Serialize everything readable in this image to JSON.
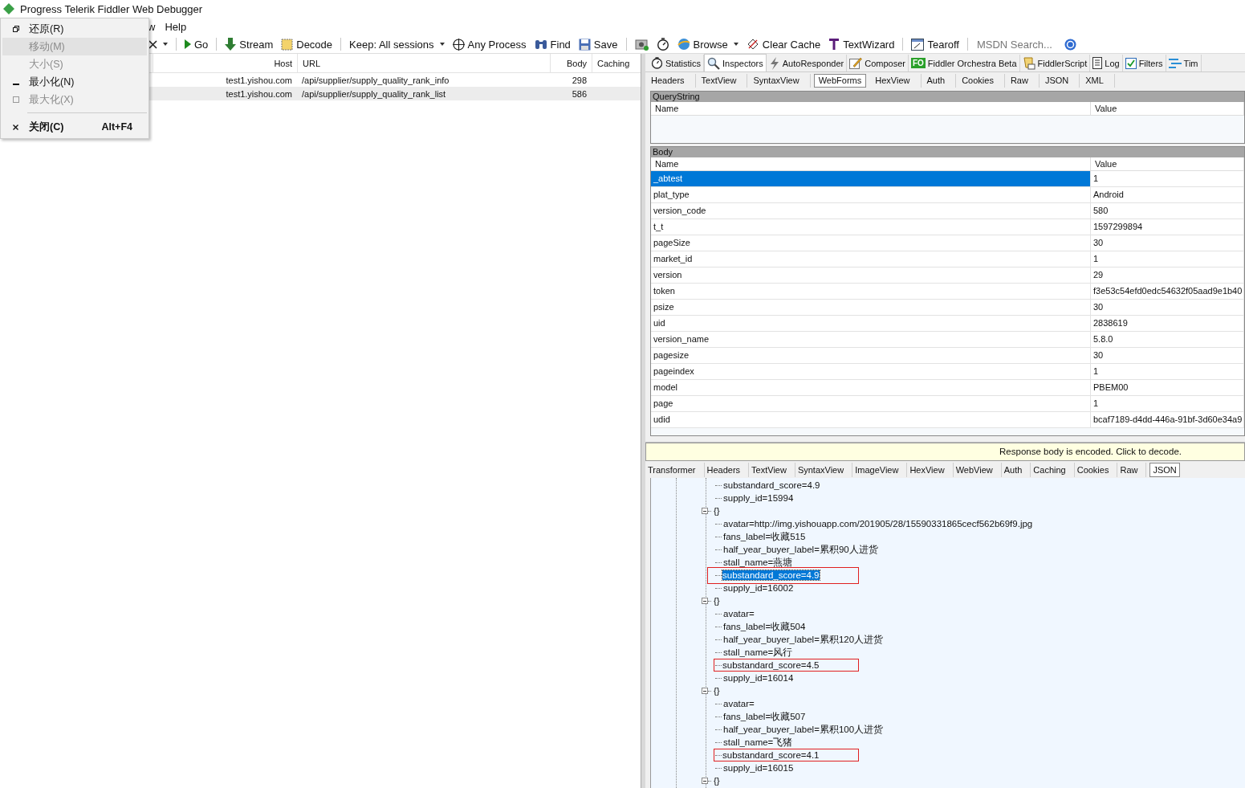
{
  "window": {
    "title": "Progress Telerik Fiddler Web Debugger"
  },
  "menu_bar": [
    "w",
    "Help"
  ],
  "toolbar": [
    {
      "kind": "remove",
      "dropdown": true
    },
    {
      "kind": "separator"
    },
    {
      "kind": "go",
      "label": "Go"
    },
    {
      "kind": "separator"
    },
    {
      "kind": "stream",
      "label": "Stream"
    },
    {
      "kind": "decode",
      "label": "Decode"
    },
    {
      "kind": "separator"
    },
    {
      "kind": "text",
      "label": "Keep: All sessions",
      "dropdown": true
    },
    {
      "kind": "process",
      "label": "Any Process"
    },
    {
      "kind": "find",
      "label": "Find"
    },
    {
      "kind": "save",
      "label": "Save"
    },
    {
      "kind": "separator"
    },
    {
      "kind": "camera"
    },
    {
      "kind": "timer"
    },
    {
      "kind": "browse",
      "label": "Browse",
      "dropdown": true
    },
    {
      "kind": "clear",
      "label": "Clear Cache"
    },
    {
      "kind": "wizard",
      "label": "TextWizard"
    },
    {
      "kind": "separator"
    },
    {
      "kind": "tearoff",
      "label": "Tearoff"
    },
    {
      "kind": "separator"
    },
    {
      "kind": "search",
      "placeholder": "MSDN Search..."
    },
    {
      "kind": "help"
    }
  ],
  "system_menu": [
    {
      "kind": "restore",
      "label": "还原(R)",
      "disabled": false,
      "selected": false,
      "default": false
    },
    {
      "kind": "move",
      "label": "移动(M)",
      "disabled": true,
      "selected": true,
      "default": false
    },
    {
      "kind": "size",
      "label": "大小(S)",
      "disabled": true,
      "selected": false,
      "default": false
    },
    {
      "kind": "minimize",
      "label": "最小化(N)",
      "disabled": false,
      "selected": false,
      "default": false
    },
    {
      "kind": "maximize",
      "label": "最大化(X)",
      "disabled": true,
      "selected": false,
      "default": false
    },
    {
      "kind": "separator"
    },
    {
      "kind": "close",
      "label": "关闭(C)",
      "shortcut": "Alt+F4",
      "disabled": false,
      "selected": false,
      "default": true
    }
  ],
  "sessions": {
    "columns": [
      "Host",
      "URL",
      "Body",
      "Caching"
    ],
    "rows": [
      {
        "host": "test1.yishou.com",
        "url": "/api/supplier/supply_quality_rank_info",
        "body": "298",
        "selected": false
      },
      {
        "host": "test1.yishou.com",
        "url": "/api/supplier/supply_quality_rank_list",
        "body": "586",
        "selected": true
      }
    ]
  },
  "top_tabs": [
    {
      "kind": "stopwatch",
      "label": "Statistics",
      "selected": false
    },
    {
      "kind": "magnifier",
      "label": "Inspectors",
      "selected": true
    },
    {
      "kind": "bolt",
      "label": "AutoResponder",
      "selected": false
    },
    {
      "kind": "pencil",
      "label": "Composer",
      "selected": false
    },
    {
      "kind": "badge",
      "badge": "FO",
      "label": "Fiddler Orchestra Beta",
      "selected": false
    },
    {
      "kind": "scroll",
      "label": "FiddlerScript",
      "selected": false
    },
    {
      "kind": "document",
      "label": "Log",
      "selected": false
    },
    {
      "kind": "checkbox",
      "label": "Filters",
      "selected": false
    },
    {
      "kind": "lines",
      "label": "Tim",
      "selected": false
    }
  ],
  "request_tabs": [
    {
      "label": "Headers",
      "selected": false
    },
    {
      "label": "TextView",
      "selected": false
    },
    {
      "label": "SyntaxView",
      "selected": false
    },
    {
      "label": "WebForms",
      "selected": true
    },
    {
      "label": "HexView",
      "selected": false
    },
    {
      "label": "Auth",
      "selected": false
    },
    {
      "label": "Cookies",
      "selected": false
    },
    {
      "label": "Raw",
      "selected": false
    },
    {
      "label": "JSON",
      "selected": false
    },
    {
      "label": "XML",
      "selected": false
    }
  ],
  "query_string": {
    "title": "QueryString",
    "columns": [
      "Name",
      "Value"
    ]
  },
  "body": {
    "title": "Body",
    "columns": [
      "Name",
      "Value"
    ],
    "rows": [
      {
        "name": "_abtest",
        "value": "1",
        "selected": true
      },
      {
        "name": "plat_type",
        "value": "Android",
        "selected": false
      },
      {
        "name": "version_code",
        "value": "580",
        "selected": false
      },
      {
        "name": "t_t",
        "value": "1597299894",
        "selected": false
      },
      {
        "name": "pageSize",
        "value": "30",
        "selected": false
      },
      {
        "name": "market_id",
        "value": "1",
        "selected": false
      },
      {
        "name": "version",
        "value": "29",
        "selected": false
      },
      {
        "name": "token",
        "value": "f3e53c54efd0edc54632f05aad9e1b40",
        "selected": false
      },
      {
        "name": "psize",
        "value": "30",
        "selected": false
      },
      {
        "name": "uid",
        "value": "2838619",
        "selected": false
      },
      {
        "name": "version_name",
        "value": "5.8.0",
        "selected": false
      },
      {
        "name": "pagesize",
        "value": "30",
        "selected": false
      },
      {
        "name": "pageindex",
        "value": "1",
        "selected": false
      },
      {
        "name": "model",
        "value": "PBEM00",
        "selected": false
      },
      {
        "name": "page",
        "value": "1",
        "selected": false
      },
      {
        "name": "udid",
        "value": "bcaf7189-d4dd-446a-91bf-3d60e34a9",
        "selected": false
      }
    ]
  },
  "response": {
    "notice": "Response body is encoded. Click to decode.",
    "tabs": [
      {
        "label": "Transformer",
        "selected": false
      },
      {
        "label": "Headers",
        "selected": false
      },
      {
        "label": "TextView",
        "selected": false
      },
      {
        "label": "SyntaxView",
        "selected": false
      },
      {
        "label": "ImageView",
        "selected": false
      },
      {
        "label": "HexView",
        "selected": false
      },
      {
        "label": "WebView",
        "selected": false
      },
      {
        "label": "Auth",
        "selected": false
      },
      {
        "label": "Caching",
        "selected": false
      },
      {
        "label": "Cookies",
        "selected": false
      },
      {
        "label": "Raw",
        "selected": false
      },
      {
        "label": "JSON",
        "selected": true
      }
    ],
    "tree": [
      {
        "children": [
          {
            "text": "substandard_score=4.9",
            "selected": false,
            "highlighted": false
          },
          {
            "text": "supply_id=15994",
            "selected": false,
            "highlighted": false
          }
        ]
      },
      {
        "label": "{}",
        "expanded": true,
        "children": [
          {
            "text": "avatar=http://img.yishouapp.com/201905/28/15590331865cecf562b69f9.jpg",
            "selected": false,
            "highlighted": false
          },
          {
            "text": "fans_label=收藏515",
            "selected": false,
            "highlighted": false
          },
          {
            "text": "half_year_buyer_label=累积90人进货",
            "selected": false,
            "highlighted": false
          },
          {
            "text": "stall_name=燕塘",
            "selected": false,
            "highlighted": false
          },
          {
            "text": "substandard_score=4.9",
            "selected": true,
            "highlighted": true
          },
          {
            "text": "supply_id=16002",
            "selected": false,
            "highlighted": false
          }
        ]
      },
      {
        "label": "{}",
        "expanded": true,
        "children": [
          {
            "text": "avatar=",
            "selected": false,
            "highlighted": false
          },
          {
            "text": "fans_label=收藏504",
            "selected": false,
            "highlighted": false
          },
          {
            "text": "half_year_buyer_label=累积120人进货",
            "selected": false,
            "highlighted": false
          },
          {
            "text": "stall_name=风行",
            "selected": false,
            "highlighted": false
          },
          {
            "text": "substandard_score=4.5",
            "selected": false,
            "highlighted": true
          },
          {
            "text": "supply_id=16014",
            "selected": false,
            "highlighted": false
          }
        ]
      },
      {
        "label": "{}",
        "expanded": true,
        "children": [
          {
            "text": "avatar=",
            "selected": false,
            "highlighted": false
          },
          {
            "text": "fans_label=收藏507",
            "selected": false,
            "highlighted": false
          },
          {
            "text": "half_year_buyer_label=累积100人进货",
            "selected": false,
            "highlighted": false
          },
          {
            "text": "stall_name=飞猪",
            "selected": false,
            "highlighted": false
          },
          {
            "text": "substandard_score=4.1",
            "selected": false,
            "highlighted": true
          },
          {
            "text": "supply_id=16015",
            "selected": false,
            "highlighted": false
          }
        ]
      },
      {
        "label": "{}",
        "expanded": true
      }
    ]
  }
}
